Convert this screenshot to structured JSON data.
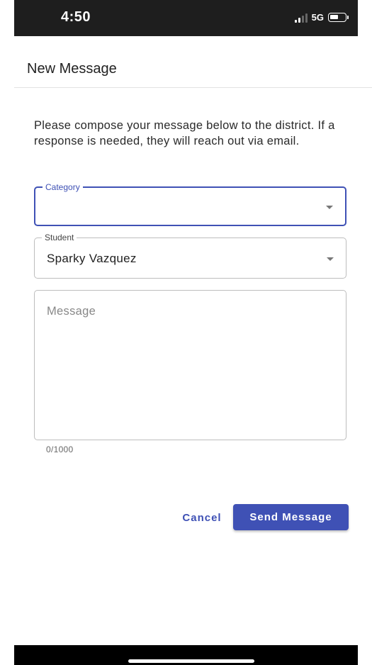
{
  "status_bar": {
    "time": "4:50",
    "network": "5G",
    "icons": [
      "signal-icon",
      "battery-icon"
    ]
  },
  "header": {
    "title": "New Message"
  },
  "intro_text": "Please compose your message below to the district. If a response is needed, they will reach out via email.",
  "form": {
    "category": {
      "label": "Category",
      "value": ""
    },
    "student": {
      "label": "Student",
      "value": "Sparky Vazquez"
    },
    "message": {
      "placeholder": "Message",
      "value": "",
      "counter": "0/1000"
    }
  },
  "actions": {
    "cancel_label": "Cancel",
    "send_label": "Send Message"
  },
  "colors": {
    "accent": "#3f51b5",
    "status_bar_bg": "#1e1e1e",
    "home_bar_bg": "#000000"
  }
}
